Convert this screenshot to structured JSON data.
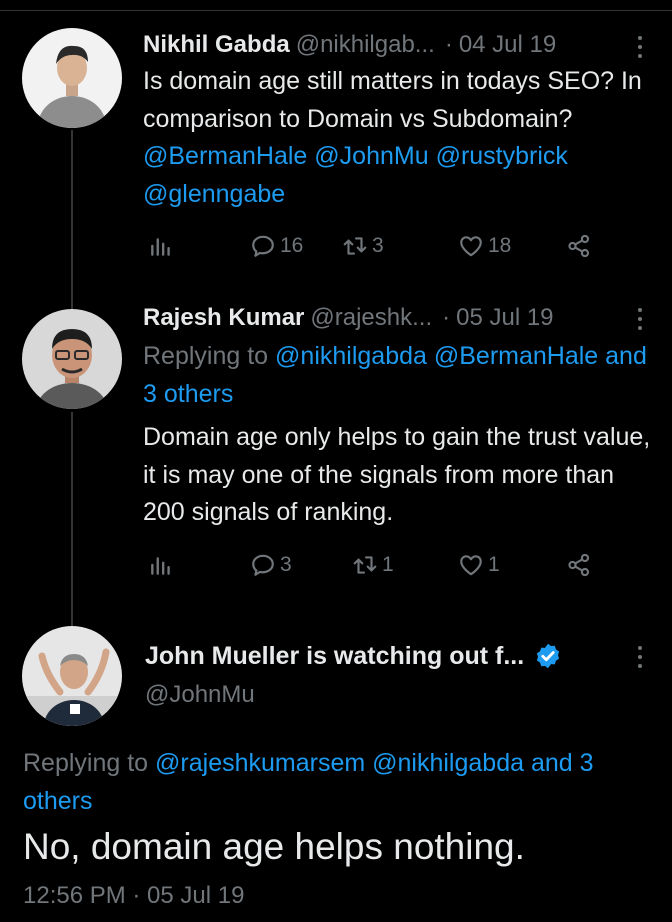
{
  "tweets": [
    {
      "name": "Nikhil Gabda",
      "handle": "@nikhilgab...",
      "separator": "·",
      "date": "04 Jul 19",
      "text_plain": "Is domain age still matters in todays SEO? In comparison to Domain vs Subdomain?",
      "mentions": [
        "@BermanHale",
        "@JohnMu",
        "@rustybrick",
        "@glenngabe"
      ],
      "stats": {
        "replies": "16",
        "retweets": "3",
        "likes": "18"
      }
    },
    {
      "name": "Rajesh Kumar",
      "handle": "@rajeshk...",
      "separator": "·",
      "date": "05 Jul 19",
      "replying_prefix": "Replying to",
      "replying_mentions": [
        "@nikhilgabda",
        "@BermanHale"
      ],
      "replying_suffix": "and 3 others",
      "text": "Domain age only helps to gain the trust value, it is may one of the signals from more than 200 signals of ranking.",
      "stats": {
        "replies": "3",
        "retweets": "1",
        "likes": "1"
      }
    }
  ],
  "main_tweet": {
    "name": "John Mueller is watching out f...",
    "handle": "@JohnMu",
    "replying_prefix": "Replying to",
    "replying_mentions": "@rajeshkumarsem @nikhilgabda and 3 others",
    "text": "No, domain age helps nothing.",
    "timestamp": "12:56 PM · 05 Jul 19"
  },
  "icons": [
    "analytics-icon",
    "reply-icon",
    "retweet-icon",
    "like-icon",
    "share-icon",
    "more-icon",
    "verified-icon"
  ],
  "colors": {
    "background": "#000000",
    "text": "#e7e9ea",
    "muted": "#71767b",
    "link": "#1d9bf0",
    "verified": "#1d9bf0"
  }
}
